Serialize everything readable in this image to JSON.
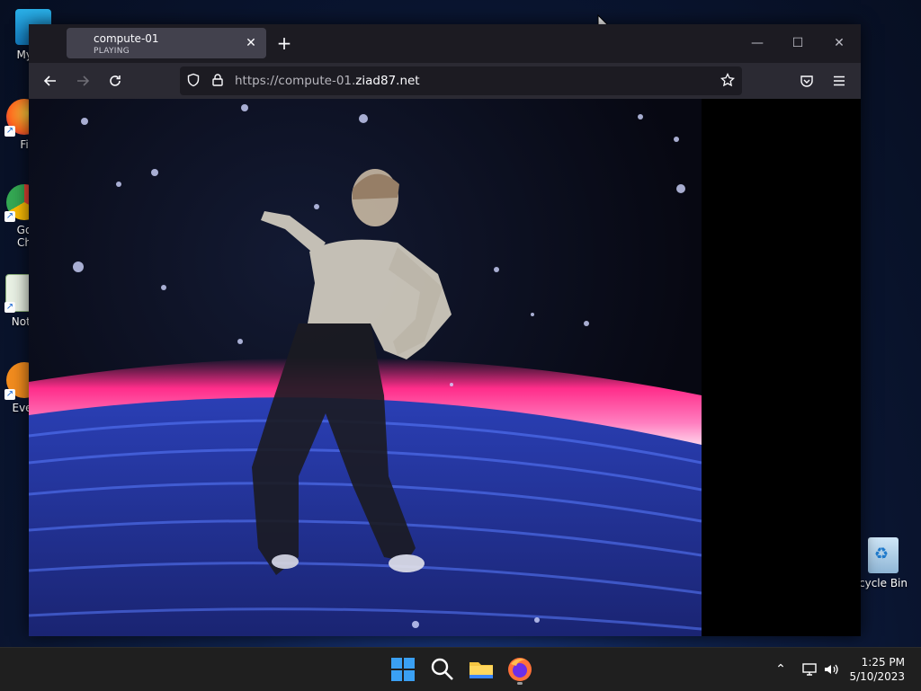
{
  "desktop": {
    "icons": [
      {
        "label": "My Co",
        "name": "my-computer"
      },
      {
        "label": "Fi",
        "name": "firefox"
      },
      {
        "label": "Go\nCh",
        "name": "google-chrome"
      },
      {
        "label": "Note",
        "name": "notepad"
      },
      {
        "label": "Ever",
        "name": "everything"
      },
      {
        "label": "cycle Bin",
        "name": "recycle-bin"
      }
    ]
  },
  "browser": {
    "tab": {
      "title": "compute-01",
      "subtitle": "PLAYING",
      "close_icon": "close-icon"
    },
    "new_tab_icon": "plus-icon",
    "window_controls": [
      "minimize-icon",
      "maximize-icon",
      "close-icon"
    ],
    "url": {
      "prefix": "https://compute-01.",
      "host": "ziad87.net"
    },
    "accent": "#2b2a33"
  },
  "taskbar": {
    "apps": [
      "windows-start-icon",
      "search-icon",
      "file-explorer-icon",
      "firefox-icon"
    ],
    "clock": {
      "time": "1:25 PM",
      "date": "5/10/2023"
    }
  }
}
